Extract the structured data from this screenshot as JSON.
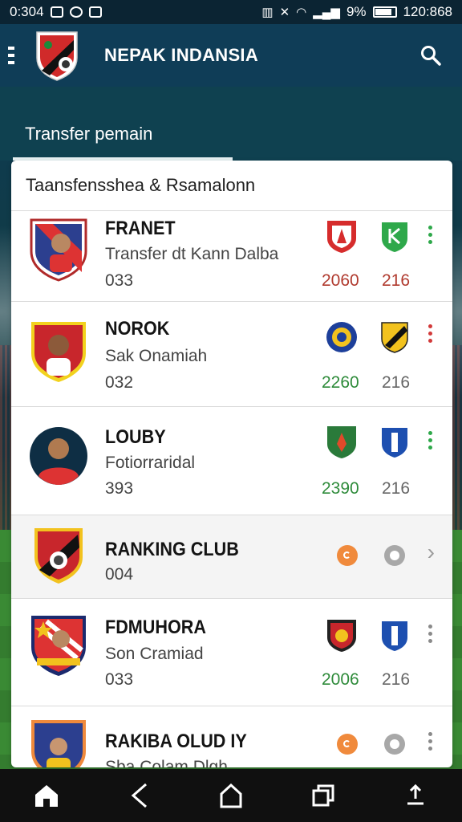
{
  "status_bar": {
    "time": "0:304",
    "clock": "120:868",
    "battery_percent": "9%"
  },
  "app_bar": {
    "title": "NEPAK INDANSIA",
    "logo_icon": "club-crest-icon",
    "menu_icon": "menu-icon",
    "search_icon": "search-icon"
  },
  "tab": {
    "label": "Transfer pemain"
  },
  "card": {
    "header": "Taansfensshea & Rsamalonn",
    "rows": [
      {
        "name": "FRANET",
        "subtitle": "Transfer dt Kann Dalba",
        "code": "033",
        "value1": "2060",
        "value2": "216",
        "value1_color": "#b03a2e",
        "value2_color": "#b03a2e",
        "menu": "green"
      },
      {
        "name": "NOROK",
        "subtitle": "Sak Onamiah",
        "code": "032",
        "value1": "2260",
        "value2": "216",
        "value1_color": "#2e8b3a",
        "value2_color": "#666666",
        "menu": "red"
      },
      {
        "name": "LOUBY",
        "subtitle": "Fotiorraridal",
        "code": "393",
        "value1": "2390",
        "value2": "216",
        "value1_color": "#2e8b3a",
        "value2_color": "#666666",
        "menu": "green"
      },
      {
        "name": "RANKING CLUB",
        "code": "004"
      },
      {
        "name": "FDMUHORA",
        "subtitle": "Son Cramiad",
        "code": "033",
        "value1": "2006",
        "value2": "216",
        "value1_color": "#2e8b3a",
        "value2_color": "#666666",
        "menu": "gray"
      },
      {
        "name": "RAKIBA OLUD IY",
        "subtitle": "Sba Colam Dlgh"
      }
    ]
  },
  "nav_bar": {
    "items": [
      "home-icon",
      "back-icon",
      "home-outline-icon",
      "recents-icon",
      "share-icon"
    ]
  },
  "colors": {
    "app_bar": "#0f3d57",
    "accent_green": "#2e8b3a",
    "accent_red": "#b03a2e"
  }
}
